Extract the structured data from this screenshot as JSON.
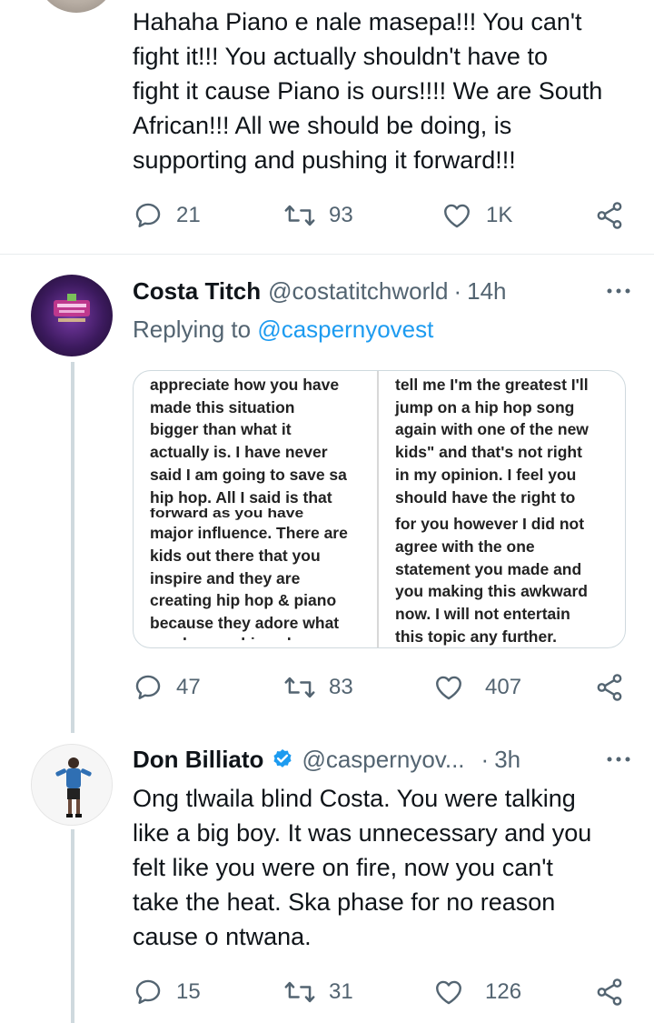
{
  "tweet1": {
    "text_lines": [
      "Hahaha Piano e nale masepa!!! You can't",
      "fight it!!! You actually shouldn't have to",
      "fight it cause Piano is ours!!!! We are South",
      "African!!! All we should be doing, is",
      "supporting and pushing it forward!!!"
    ],
    "replies": "21",
    "retweets": "93",
    "likes": "1K"
  },
  "tweet2": {
    "name": "Costa Titch",
    "handle": "@costatitchworld",
    "dot": "·",
    "time": "14h",
    "replying_label": "Replying to",
    "replying_mention": "@caspernyovest",
    "image_left_lines": [
      "appreciate how you have",
      "made this situation",
      "bigger than what it",
      "actually is. I have never",
      "said I am going to save sa",
      "hip hop. All I said is that",
      "forward as you have",
      "major influence. There are",
      "kids out there that you",
      "inspire and they are",
      "creating hip hop & piano",
      "because they adore what",
      "you have achieved"
    ],
    "image_right_lines": [
      "tell me I'm the greatest I'll",
      "jump on a hip hop song",
      "again with one of the new",
      "kids\" and that's not right",
      "in my opinion. I feel you",
      "should have the right to",
      "for you however I did not",
      "agree with the one",
      "statement you made and",
      "you making this awkward",
      "now. I will not entertain",
      "this topic any further."
    ],
    "replies": "47",
    "retweets": "83",
    "likes": "407"
  },
  "tweet3": {
    "name": "Don Billiato",
    "handle": "@caspernyov...",
    "dot": "·",
    "time": "3h",
    "text_lines": [
      "Ong tlwaila blind Costa. You were talking",
      "like a big boy. It was unnecessary and you",
      "felt like you were on fire,  now you can't",
      "take the heat. Ska phase for no reason",
      "cause o ntwana."
    ],
    "replies": "15",
    "retweets": "31",
    "likes": "126"
  },
  "colors": {
    "text": "#0f1419",
    "muted": "#536471",
    "link": "#1d9bf0",
    "verified": "#1d9bf0",
    "thread_line": "#cfd9de"
  },
  "icons": [
    "reply-icon",
    "retweet-icon",
    "like-icon",
    "share-icon",
    "more-icon",
    "verified-badge-icon"
  ]
}
